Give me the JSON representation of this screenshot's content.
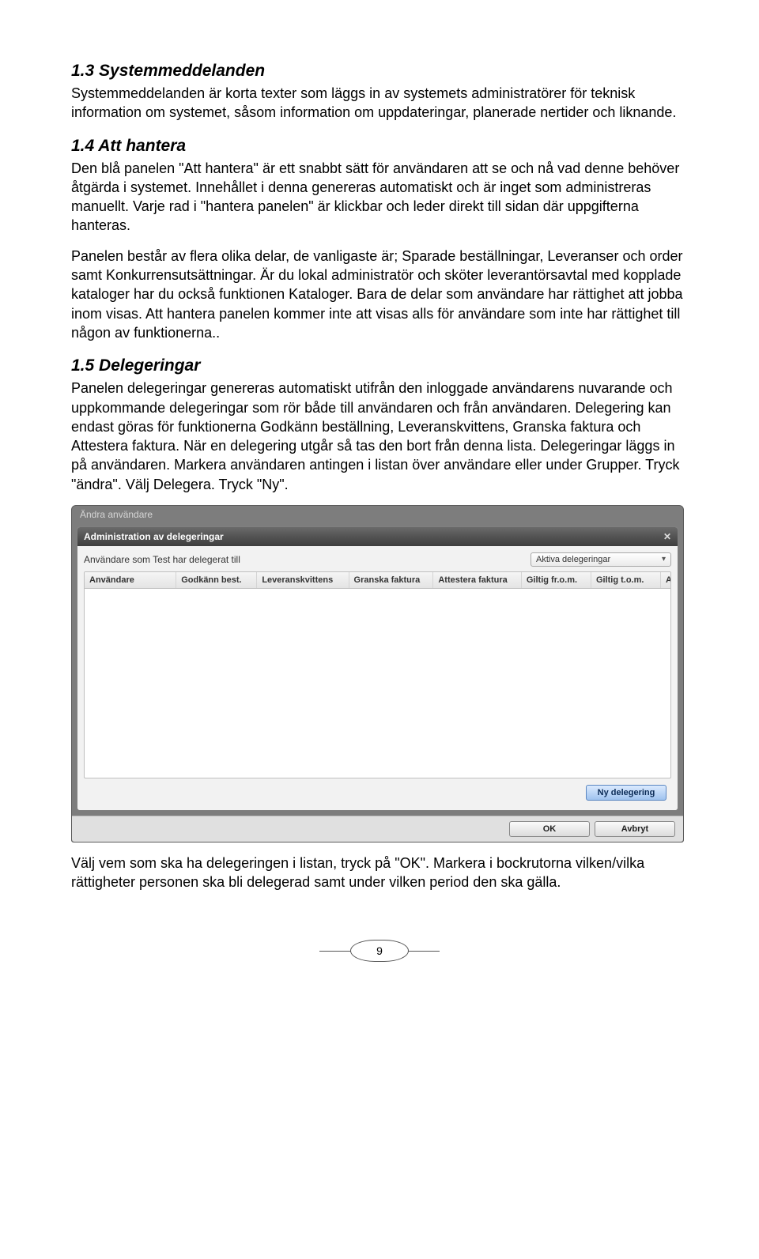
{
  "sections": {
    "s13": {
      "heading": "1.3  Systemmeddelanden",
      "p1": "Systemmeddelanden är korta texter som läggs in av systemets administratörer för teknisk information om systemet, såsom information om uppdateringar, planerade nertider och liknande."
    },
    "s14": {
      "heading": "1.4  Att hantera",
      "p1": "Den blå panelen \"Att hantera\" är ett snabbt sätt för användaren att se och nå vad denne behöver åtgärda i systemet. Innehållet i denna genereras automatiskt och är inget som administreras manuellt. Varje rad i \"hantera panelen\" är klickbar och leder direkt till sidan där uppgifterna hanteras.",
      "p2": "Panelen består av flera olika delar, de vanligaste är; Sparade beställningar, Leveranser och order samt Konkurrensutsättningar. Är du lokal administratör och sköter leverantörsavtal med kopplade kataloger har du också funktionen Kataloger. Bara de delar som användare har rättighet att jobba inom visas. Att hantera panelen kommer inte att visas alls för användare som inte har rättighet till någon av funktionerna.."
    },
    "s15": {
      "heading": "1.5  Delegeringar",
      "p1": "Panelen delegeringar genereras automatiskt utifrån den inloggade användarens nuvarande och uppkommande delegeringar som rör både till användaren och från användaren. Delegering kan endast göras för funktionerna Godkänn beställning, Leveranskvittens, Granska faktura och Attestera faktura. När en delegering utgår så tas den bort från denna lista. Delegeringar läggs in på användaren. Markera användaren antingen i listan över användare eller under Grupper. Tryck \"ändra\". Välj Delegera. Tryck \"Ny\".",
      "p2": "Välj vem som ska ha delegeringen i listan, tryck på \"OK\". Markera i bockrutorna vilken/vilka rättigheter personen ska bli delegerad samt under vilken period den ska gälla."
    }
  },
  "modal": {
    "outer_title": "Ändra användare",
    "inner_title": "Administration av delegeringar",
    "user_label": "Användare som Test har delegerat till",
    "select_value": "Aktiva delegeringar",
    "columns": {
      "user": "Användare",
      "godk": "Godkänn best.",
      "lev": "Leveranskvittens",
      "gransk": "Granska faktura",
      "attest": "Attestera faktura",
      "from": "Giltig fr.o.m.",
      "to": "Giltig t.o.m.",
      "avsl": "Avsluta"
    },
    "btn_new": "Ny delegering",
    "btn_ok": "OK",
    "btn_cancel": "Avbryt"
  },
  "page_number": "9"
}
